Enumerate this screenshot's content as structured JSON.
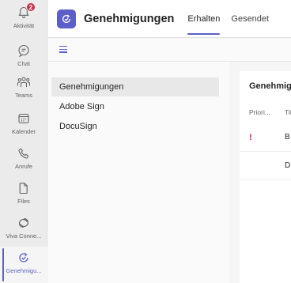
{
  "rail": {
    "items": [
      {
        "label": "Aktivität",
        "icon": "bell-icon",
        "badge": "2"
      },
      {
        "label": "Chat",
        "icon": "chat-icon"
      },
      {
        "label": "Teams",
        "icon": "teams-icon"
      },
      {
        "label": "Kalender",
        "icon": "calendar-icon"
      },
      {
        "label": "Anrufe",
        "icon": "phone-icon"
      },
      {
        "label": "Files",
        "icon": "file-icon"
      },
      {
        "label": "Viva Conne...",
        "icon": "viva-connections-icon"
      },
      {
        "label": "Genehmigu...",
        "icon": "approvals-icon",
        "active": true
      }
    ]
  },
  "header": {
    "title": "Genehmigungen",
    "tabs": [
      {
        "label": "Erhalten",
        "active": true
      },
      {
        "label": "Gesendet"
      }
    ]
  },
  "nav": {
    "items": [
      {
        "label": "Genehmigungen",
        "selected": true
      },
      {
        "label": "Adobe Sign"
      },
      {
        "label": "DocuSign"
      }
    ]
  },
  "main": {
    "title": "Genehmigungen",
    "columns": [
      "Priori...",
      "Titel"
    ],
    "rows": [
      {
        "priority": "!",
        "title": "B"
      },
      {
        "priority": "",
        "title": "D"
      }
    ]
  },
  "colors": {
    "accent": "#5b5fc7",
    "badge": "#c4314b",
    "priority": "#c4314b"
  }
}
